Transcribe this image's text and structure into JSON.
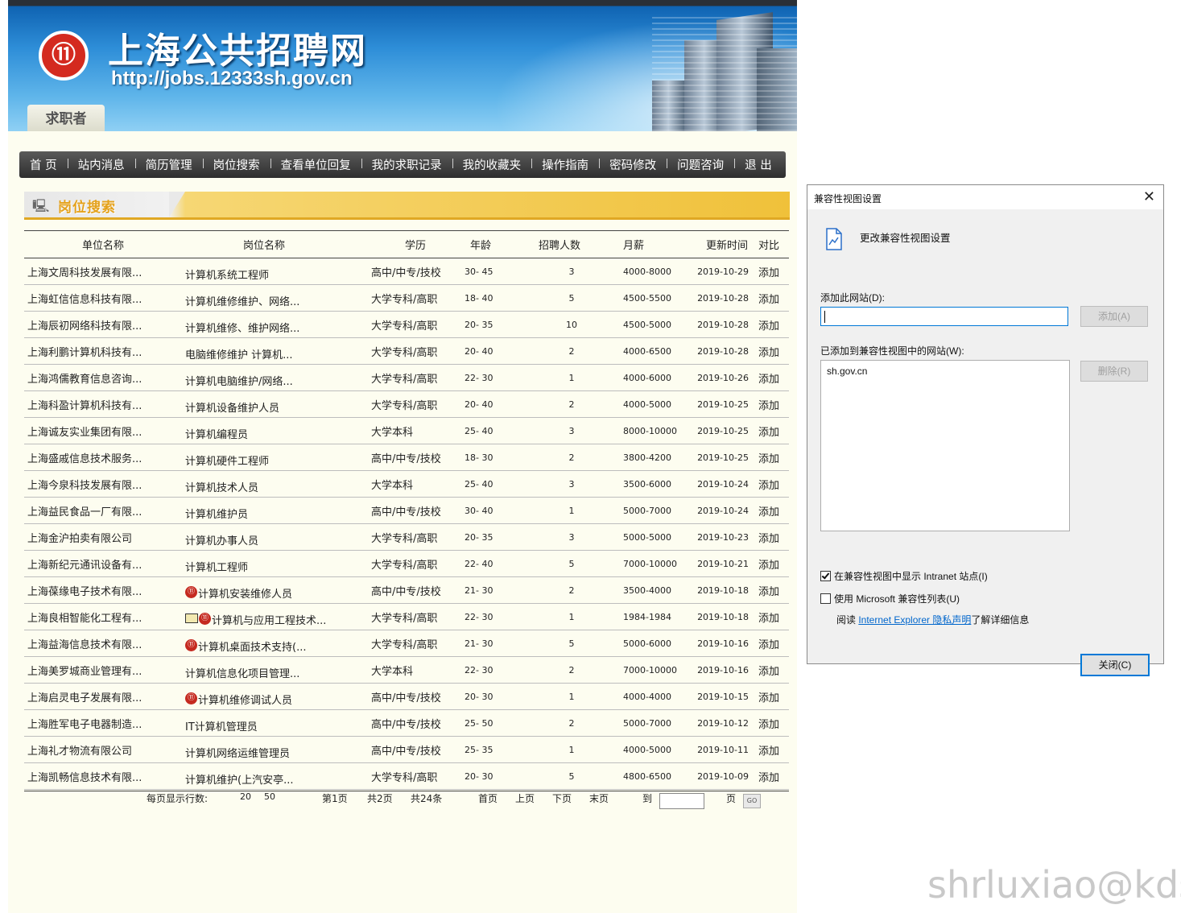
{
  "header": {
    "site_title": "上海公共招聘网",
    "site_url": "http://jobs.12333sh.gov.cn",
    "role_tab": "求职者"
  },
  "nav": [
    "首 页",
    "站内消息",
    "简历管理",
    "岗位搜索",
    "查看单位回复",
    "我的求职记录",
    "我的收藏夹",
    "操作指南",
    "密码修改",
    "问题咨询",
    "退 出"
  ],
  "section_title": "岗位搜索",
  "table": {
    "headers": [
      "单位名称",
      "岗位名称",
      "学历",
      "年龄",
      "招聘人数",
      "月薪",
      "更新时间",
      "对比"
    ],
    "rows": [
      {
        "company": "上海文周科技发展有限...",
        "position": "计算机系统工程师",
        "education": "高中/中专/技校",
        "age": "30- 45",
        "count": "3",
        "salary": "4000-8000",
        "date": "2019-10-29",
        "compare": "添加",
        "icon": ""
      },
      {
        "company": "上海虹信信息科技有限...",
        "position": "计算机维修维护、网络...",
        "education": "大学专科/高职",
        "age": "18- 40",
        "count": "5",
        "salary": "4500-5500",
        "date": "2019-10-28",
        "compare": "添加",
        "icon": ""
      },
      {
        "company": "上海辰初网络科技有限...",
        "position": "计算机维修、维护网络...",
        "education": "大学专科/高职",
        "age": "20- 35",
        "count": "10",
        "salary": "4500-5000",
        "date": "2019-10-28",
        "compare": "添加",
        "icon": ""
      },
      {
        "company": "上海利鹏计算机科技有...",
        "position": "电脑维修维护 计算机...",
        "education": "大学专科/高职",
        "age": "20- 40",
        "count": "2",
        "salary": "4000-6500",
        "date": "2019-10-28",
        "compare": "添加",
        "icon": ""
      },
      {
        "company": "上海鸿儒教育信息咨询...",
        "position": "计算机电脑维护/网络...",
        "education": "大学专科/高职",
        "age": "22- 30",
        "count": "1",
        "salary": "4000-6000",
        "date": "2019-10-26",
        "compare": "添加",
        "icon": ""
      },
      {
        "company": "上海科盈计算机科技有...",
        "position": "计算机设备维护人员",
        "education": "大学专科/高职",
        "age": "20- 40",
        "count": "2",
        "salary": "4000-5000",
        "date": "2019-10-25",
        "compare": "添加",
        "icon": ""
      },
      {
        "company": "上海诚友实业集团有限...",
        "position": "计算机编程员",
        "education": "大学本科",
        "age": "25- 40",
        "count": "3",
        "salary": "8000-10000",
        "date": "2019-10-25",
        "compare": "添加",
        "icon": ""
      },
      {
        "company": "上海盛戚信息技术服务...",
        "position": "计算机硬件工程师",
        "education": "高中/中专/技校",
        "age": "18- 30",
        "count": "2",
        "salary": "3800-4200",
        "date": "2019-10-25",
        "compare": "添加",
        "icon": ""
      },
      {
        "company": "上海今泉科技发展有限...",
        "position": "计算机技术人员",
        "education": "大学本科",
        "age": "25- 40",
        "count": "3",
        "salary": "3500-6000",
        "date": "2019-10-24",
        "compare": "添加",
        "icon": ""
      },
      {
        "company": "上海益民食品一厂有限...",
        "position": "计算机维护员",
        "education": "高中/中专/技校",
        "age": "30- 40",
        "count": "1",
        "salary": "5000-7000",
        "date": "2019-10-24",
        "compare": "添加",
        "icon": ""
      },
      {
        "company": "上海金沪拍卖有限公司",
        "position": "计算机办事人员",
        "education": "大学专科/高职",
        "age": "20- 35",
        "count": "3",
        "salary": "5000-5000",
        "date": "2019-10-23",
        "compare": "添加",
        "icon": ""
      },
      {
        "company": "上海新纪元通讯设备有...",
        "position": "计算机工程师",
        "education": "大学专科/高职",
        "age": "22- 40",
        "count": "5",
        "salary": "7000-10000",
        "date": "2019-10-21",
        "compare": "添加",
        "icon": ""
      },
      {
        "company": "上海葆缘电子技术有限...",
        "position": "计算机安装维修人员",
        "education": "高中/中专/技校",
        "age": "21- 30",
        "count": "2",
        "salary": "3500-4000",
        "date": "2019-10-18",
        "compare": "添加",
        "icon": "logo"
      },
      {
        "company": "上海良相智能化工程有...",
        "position": "计算机与应用工程技术...",
        "education": "大学专科/高职",
        "age": "22- 30",
        "count": "1",
        "salary": "1984-1984",
        "date": "2019-10-18",
        "compare": "添加",
        "icon": "mail-logo"
      },
      {
        "company": "上海益海信息技术有限...",
        "position": "计算机桌面技术支持(...",
        "education": "大学专科/高职",
        "age": "21- 30",
        "count": "5",
        "salary": "5000-6000",
        "date": "2019-10-16",
        "compare": "添加",
        "icon": "logo"
      },
      {
        "company": "上海美罗城商业管理有...",
        "position": "计算机信息化项目管理...",
        "education": "大学本科",
        "age": "22- 30",
        "count": "2",
        "salary": "7000-10000",
        "date": "2019-10-16",
        "compare": "添加",
        "icon": ""
      },
      {
        "company": "上海启灵电子发展有限...",
        "position": "计算机维修调试人员",
        "education": "高中/中专/技校",
        "age": "20- 30",
        "count": "1",
        "salary": "4000-4000",
        "date": "2019-10-15",
        "compare": "添加",
        "icon": "logo"
      },
      {
        "company": "上海胜军电子电器制造...",
        "position": "IT计算机管理员",
        "education": "高中/中专/技校",
        "age": "25- 50",
        "count": "2",
        "salary": "5000-7000",
        "date": "2019-10-12",
        "compare": "添加",
        "icon": ""
      },
      {
        "company": "上海礼才物流有限公司",
        "position": "计算机网络运维管理员",
        "education": "高中/中专/技校",
        "age": "25- 35",
        "count": "1",
        "salary": "4000-5000",
        "date": "2019-10-11",
        "compare": "添加",
        "icon": ""
      },
      {
        "company": "上海凯畅信息技术有限...",
        "position": "计算机维护(上汽安亭...",
        "education": "大学专科/高职",
        "age": "20- 30",
        "count": "5",
        "salary": "4800-6500",
        "date": "2019-10-09",
        "compare": "添加",
        "icon": ""
      }
    ]
  },
  "pager": {
    "rows_label": "每页显示行数:",
    "opt20": "20",
    "opt50": "50",
    "current_page": "第1页",
    "total_pages": "共2页",
    "total_items": "共24条",
    "first": "首页",
    "prev": "上页",
    "next": "下页",
    "last": "末页",
    "goto": "到",
    "page_unit": "页",
    "go": "GO"
  },
  "dialog": {
    "title": "兼容性视图设置",
    "close_x": "✕",
    "heading": "更改兼容性视图设置",
    "add_label": "添加此网站(D):",
    "add_input_value": "",
    "add_button": "添加(A)",
    "list_label": "已添加到兼容性视图中的网站(W):",
    "sites": [
      "sh.gov.cn"
    ],
    "remove_button": "删除(R)",
    "intranet_label": "在兼容性视图中显示 Intranet 站点(I)",
    "intranet_checked": true,
    "mslist_label": "使用 Microsoft 兼容性列表(U)",
    "mslist_checked": false,
    "privacy_prefix": "阅读 ",
    "privacy_link": "Internet Explorer 隐私声明",
    "privacy_suffix": "了解详细信息",
    "close_button": "关闭(C)"
  },
  "watermark": "shrluxiao@kds"
}
